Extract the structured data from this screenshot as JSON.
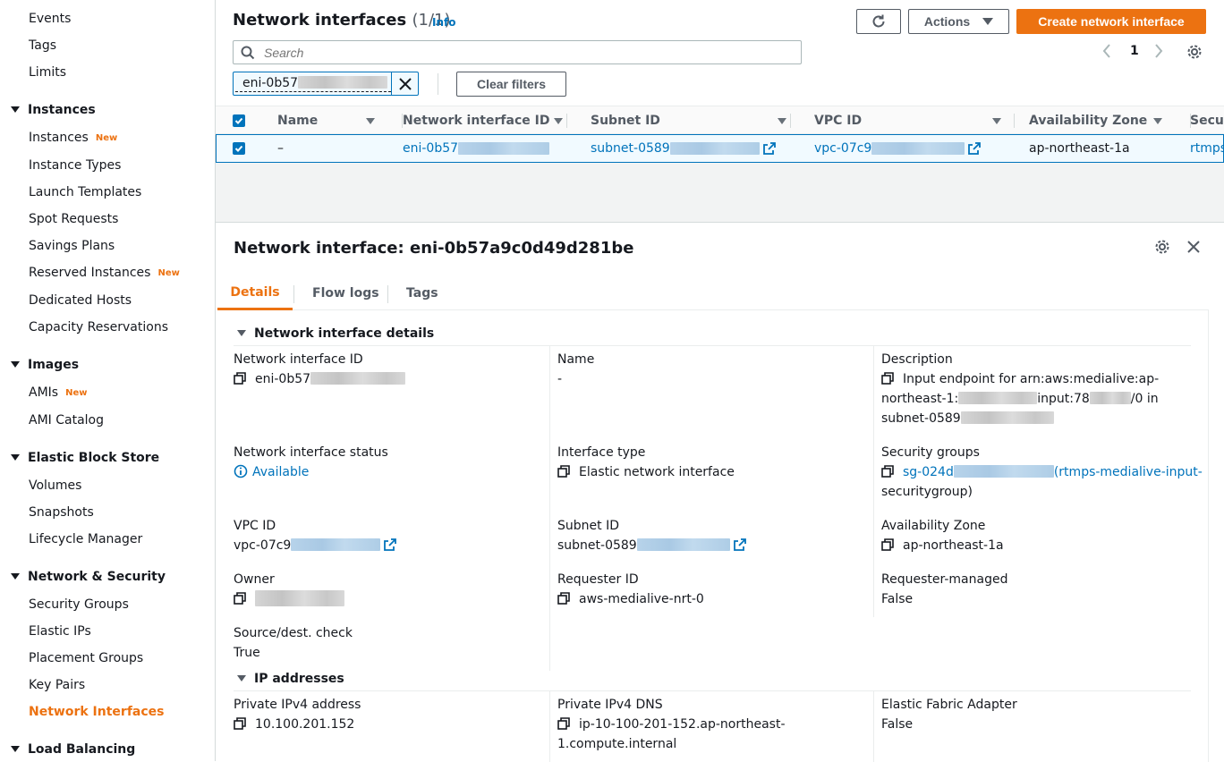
{
  "sidebar": {
    "items_top": [
      "Events",
      "Tags",
      "Limits"
    ],
    "sections": [
      {
        "title": "Instances",
        "items": [
          {
            "label": "Instances",
            "badge": "New"
          },
          {
            "label": "Instance Types"
          },
          {
            "label": "Launch Templates"
          },
          {
            "label": "Spot Requests"
          },
          {
            "label": "Savings Plans"
          },
          {
            "label": "Reserved Instances",
            "badge": "New"
          },
          {
            "label": "Dedicated Hosts"
          },
          {
            "label": "Capacity Reservations"
          }
        ]
      },
      {
        "title": "Images",
        "items": [
          {
            "label": "AMIs",
            "badge": "New"
          },
          {
            "label": "AMI Catalog"
          }
        ]
      },
      {
        "title": "Elastic Block Store",
        "items": [
          {
            "label": "Volumes"
          },
          {
            "label": "Snapshots"
          },
          {
            "label": "Lifecycle Manager"
          }
        ]
      },
      {
        "title": "Network & Security",
        "items": [
          {
            "label": "Security Groups"
          },
          {
            "label": "Elastic IPs"
          },
          {
            "label": "Placement Groups"
          },
          {
            "label": "Key Pairs"
          },
          {
            "label": "Network Interfaces",
            "active": true
          }
        ]
      },
      {
        "title": "Load Balancing",
        "items": []
      }
    ],
    "active_color": "#ec7211"
  },
  "header": {
    "title": "Network interfaces",
    "count": "(1/1)",
    "info": "Info",
    "refresh_icon": "refresh-icon",
    "actions_label": "Actions",
    "create_label": "Create network interface",
    "search_placeholder": "Search",
    "filter_token": "eni-0b57",
    "clear_filters": "Clear filters",
    "page": "1"
  },
  "table": {
    "columns": [
      "Name",
      "Network interface ID",
      "Subnet ID",
      "VPC ID",
      "Availability Zone",
      "Securi"
    ],
    "row": {
      "name": "–",
      "eni": "eni-0b57",
      "subnet": "subnet-0589",
      "vpc": "vpc-07c9",
      "az": "ap-northeast-1a",
      "sg": "rtmps"
    }
  },
  "details": {
    "title": "Network interface: eni-0b57a9c0d49d281be",
    "tabs": [
      "Details",
      "Flow logs",
      "Tags"
    ],
    "section1": "Network interface details",
    "section2": "IP addresses",
    "fields": {
      "eni_id": {
        "label": "Network interface ID",
        "value": "eni-0b57"
      },
      "name": {
        "label": "Name",
        "value": "-"
      },
      "description": {
        "label": "Description",
        "line1": "Input endpoint for arn:aws:medialive:ap-",
        "line2a": "northeast-1:",
        "line2b": "input:78",
        "line2c": "/0 in",
        "line3": "subnet-0589"
      },
      "status": {
        "label": "Network interface status",
        "value": "Available"
      },
      "interface_type": {
        "label": "Interface type",
        "value": "Elastic network interface"
      },
      "security_groups": {
        "label": "Security groups",
        "value_a": "sg-024d",
        "value_b": "(rtmps-medialive-input-",
        "value_c": "securitygroup)"
      },
      "vpc_id": {
        "label": "VPC ID",
        "value": "vpc-07c9"
      },
      "subnet_id": {
        "label": "Subnet ID",
        "value": "subnet-0589"
      },
      "az": {
        "label": "Availability Zone",
        "value": "ap-northeast-1a"
      },
      "owner": {
        "label": "Owner"
      },
      "requester_id": {
        "label": "Requester ID",
        "value": "aws-medialive-nrt-0"
      },
      "requester_managed": {
        "label": "Requester-managed",
        "value": "False"
      },
      "src_dest": {
        "label": "Source/dest. check",
        "value": "True"
      },
      "private_ipv4": {
        "label": "Private IPv4 address",
        "value": "10.100.201.152"
      },
      "private_dns": {
        "label": "Private IPv4 DNS",
        "line1": "ip-10-100-201-152.ap-northeast-",
        "line2": "1.compute.internal"
      },
      "efa": {
        "label": "Elastic Fabric Adapter",
        "value": "False"
      }
    }
  }
}
